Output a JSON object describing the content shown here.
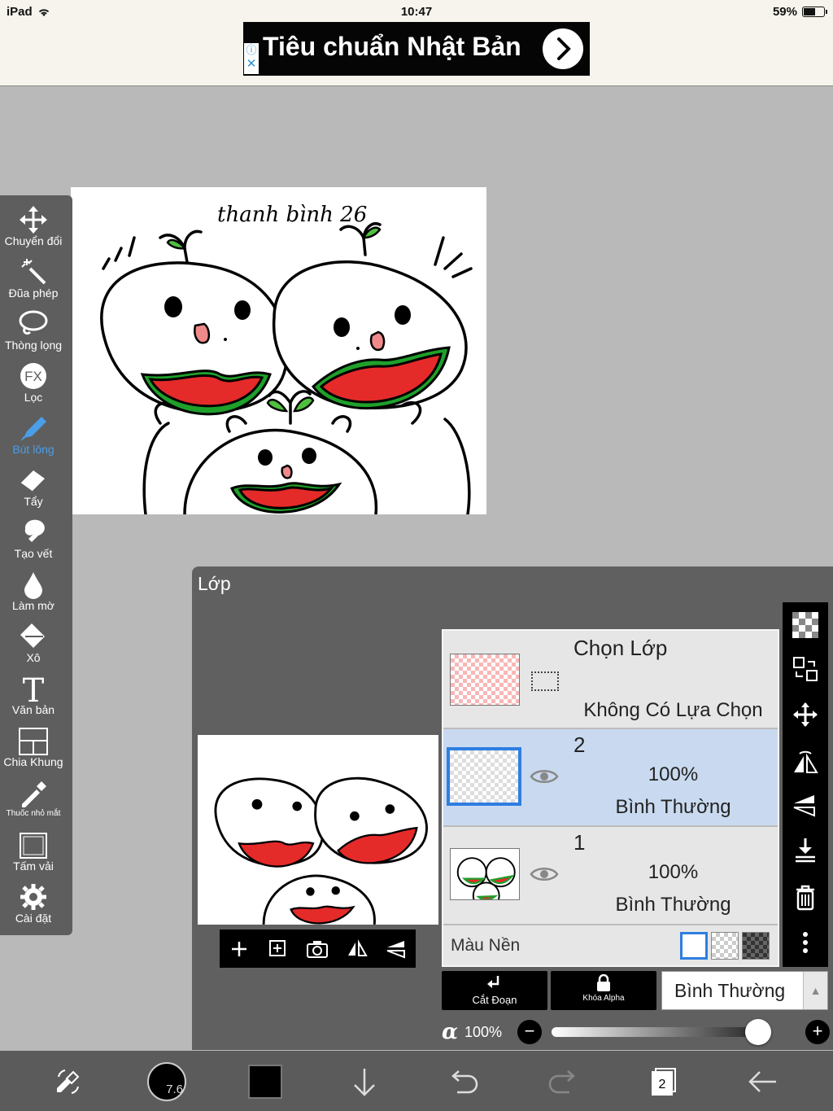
{
  "status": {
    "device": "iPad",
    "time": "10:47",
    "battery": "59%"
  },
  "ad": {
    "text": "Tiêu chuẩn Nhật Bản",
    "info_icon": "info-icon",
    "close_icon": "close-icon"
  },
  "canvas": {
    "signature": "thanh bình 26"
  },
  "toolbar": [
    {
      "name": "transform",
      "label": "Chuyển đổi",
      "icon": "move-arrows-icon"
    },
    {
      "name": "magic-wand",
      "label": "Đũa phép",
      "icon": "magic-wand-icon"
    },
    {
      "name": "lasso",
      "label": "Thòng lọng",
      "icon": "lasso-icon"
    },
    {
      "name": "filter",
      "label": "Lọc",
      "icon": "fx-icon"
    },
    {
      "name": "brush",
      "label": "Bút lông",
      "icon": "brush-icon",
      "active": true
    },
    {
      "name": "eraser",
      "label": "Tẩy",
      "icon": "eraser-icon"
    },
    {
      "name": "smudge",
      "label": "Tạo vết",
      "icon": "smudge-icon"
    },
    {
      "name": "blur",
      "label": "Làm mờ",
      "icon": "blur-drop-icon"
    },
    {
      "name": "bucket",
      "label": "Xô",
      "icon": "bucket-icon"
    },
    {
      "name": "text",
      "label": "Văn bản",
      "icon": "text-icon"
    },
    {
      "name": "frame-divider",
      "label": "Chia Khung",
      "icon": "frame-divider-icon"
    },
    {
      "name": "eyedropper",
      "label": "Thuốc nhỏ mắt",
      "icon": "eyedropper-icon"
    },
    {
      "name": "canvas",
      "label": "Tấm vải",
      "icon": "canvas-icon"
    },
    {
      "name": "settings",
      "label": "Cài đặt",
      "icon": "gear-icon"
    }
  ],
  "layers_panel": {
    "title": "Lớp",
    "selection_layer": {
      "title": "Chọn Lớp",
      "status": "Không Có Lựa Chọn"
    },
    "layers": [
      {
        "number": "2",
        "opacity": "100%",
        "blend": "Bình Thường",
        "selected": true
      },
      {
        "number": "1",
        "opacity": "100%",
        "blend": "Bình Thường",
        "selected": false
      }
    ],
    "background_label": "Màu Nền",
    "clip_label": "Cắt Đoạn",
    "alpha_lock_label": "Khóa Alpha",
    "blend_mode": "Bình Thường",
    "alpha_symbol": "α",
    "alpha_value": "100%",
    "alpha_fraction": 1.0
  },
  "bottombar": {
    "brush_size": "7.6",
    "layer_count": "2",
    "primary_color": "#000000"
  },
  "colors": {
    "accent": "#4a9eea",
    "selected_row": "#c9daf0",
    "panel": "#606060",
    "toolbar": "#5e5e5e"
  }
}
